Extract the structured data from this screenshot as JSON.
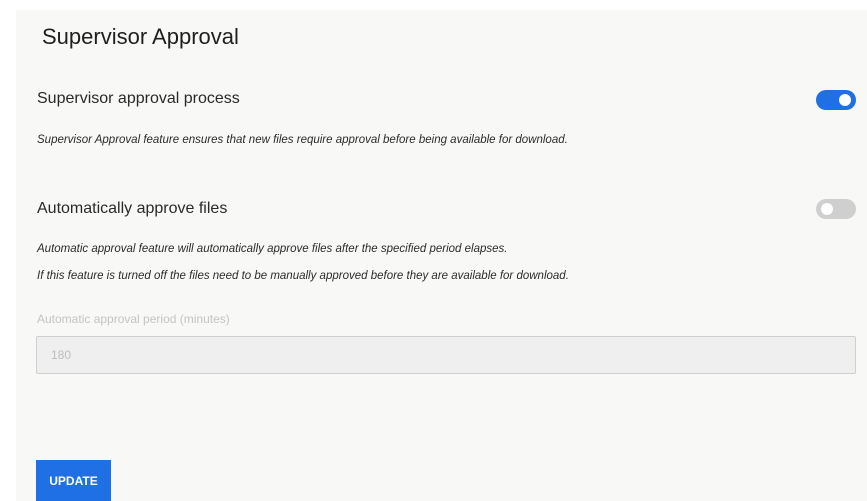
{
  "page": {
    "title": "Supervisor Approval"
  },
  "supervisor_approval": {
    "label": "Supervisor approval process",
    "enabled": true,
    "description": "Supervisor Approval feature ensures that new files require approval before being available for download."
  },
  "auto_approve": {
    "label": "Automatically approve files",
    "enabled": false,
    "description_1": "Automatic approval feature will automatically approve files after the specified period elapses.",
    "description_2": "If this feature is turned off the files need to be manually approved before they are available for download."
  },
  "approval_period": {
    "label": "Automatic approval period (minutes)",
    "value": "180",
    "disabled": true
  },
  "actions": {
    "update_label": "UPDATE"
  },
  "colors": {
    "accent": "#1f6fe5",
    "toggle_off": "#cfcfcf",
    "panel_bg": "#f8f8f7"
  }
}
